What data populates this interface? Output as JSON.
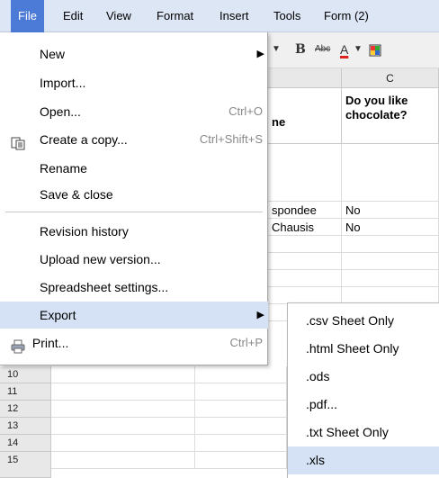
{
  "menubar": {
    "items": [
      "File",
      "Edit",
      "View",
      "Format",
      "Insert",
      "Tools",
      "Form (2)"
    ]
  },
  "toolbar": {
    "bold": "B",
    "strike": "Abc",
    "textcolor": "A"
  },
  "sheet": {
    "column_c": "C",
    "header_b_fragment": "ne",
    "header_c": "Do you like chocolate?",
    "rows": [
      {
        "b": "spondee",
        "c": "No"
      },
      {
        "b": "Chausis",
        "c": "No"
      }
    ],
    "row_numbers": [
      "10",
      "11",
      "12",
      "13",
      "14",
      "15"
    ]
  },
  "file_menu": {
    "new": "New",
    "import": "Import...",
    "open": "Open...",
    "open_shortcut": "Ctrl+O",
    "create_copy": "Create a copy...",
    "create_copy_shortcut": "Ctrl+Shift+S",
    "rename": "Rename",
    "save_close": "Save & close",
    "revision_history": "Revision history",
    "upload_new_version": "Upload new version...",
    "spreadsheet_settings": "Spreadsheet settings...",
    "export": "Export",
    "print": "Print...",
    "print_shortcut": "Ctrl+P"
  },
  "export_submenu": {
    "items": [
      ".csv Sheet Only",
      ".html Sheet Only",
      ".ods",
      ".pdf...",
      ".txt Sheet Only",
      ".xls"
    ]
  },
  "colors": {
    "menubar_bg": "#dde6f5",
    "active_menu": "#4b7bd6",
    "hover_bg": "#d5e2f5"
  }
}
